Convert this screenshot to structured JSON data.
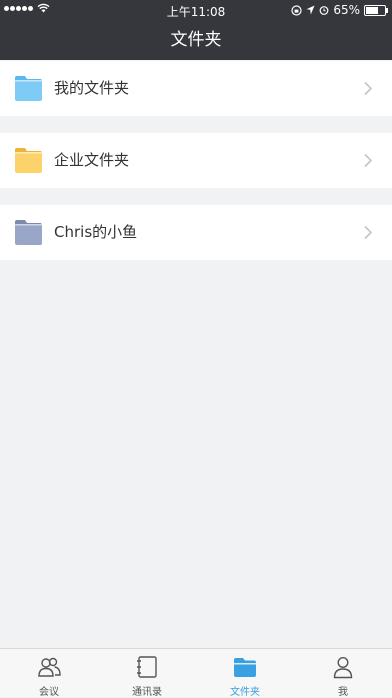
{
  "status": {
    "time": "上午11:08",
    "battery": "65%",
    "battery_level": 0.65
  },
  "nav": {
    "title": "文件夹"
  },
  "folders": [
    {
      "label": "我的文件夹",
      "color": "#7ecbf6",
      "tab": "#5ab8ee",
      "icon": "folder-icon"
    },
    {
      "label": "企业文件夹",
      "color": "#fcd36b",
      "tab": "#f0b33a",
      "icon": "folder-icon"
    },
    {
      "label": "Chris的小鱼",
      "color": "#9aa6c8",
      "tab": "#7d89ad",
      "icon": "folder-icon"
    }
  ],
  "tabs": [
    {
      "label": "会议",
      "icon": "meeting-icon"
    },
    {
      "label": "通讯录",
      "icon": "contacts-icon"
    },
    {
      "label": "文件夹",
      "icon": "folder-icon",
      "active": true
    },
    {
      "label": "我",
      "icon": "person-icon"
    }
  ],
  "colors": {
    "header": "#35373d",
    "accent": "#3aa0e0",
    "background": "#f1f2f4"
  }
}
